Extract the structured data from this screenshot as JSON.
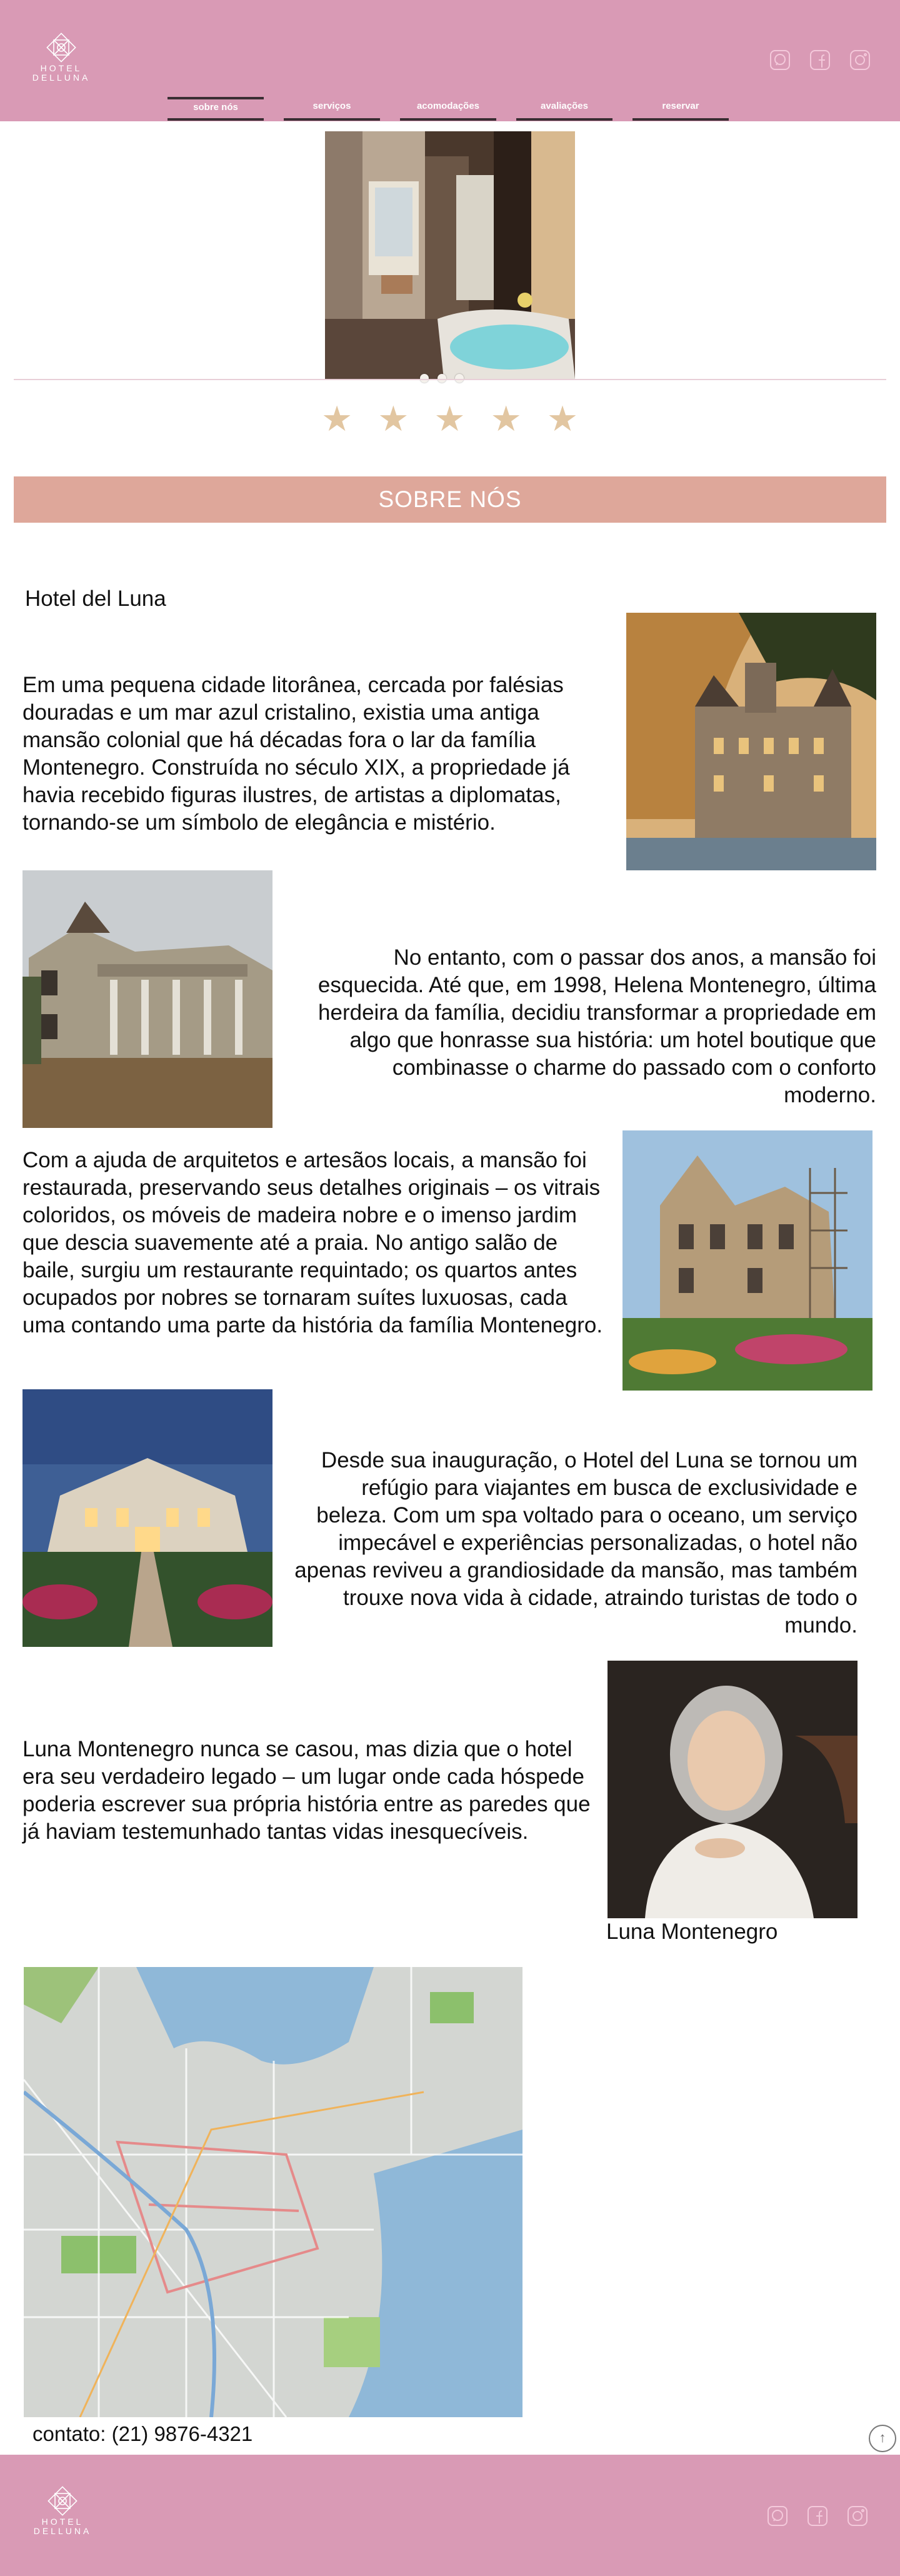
{
  "brand": {
    "line1": "HOTEL",
    "line2": "DELLUNA"
  },
  "social": [
    "whatsapp-icon",
    "facebook-icon",
    "instagram-icon"
  ],
  "nav": [
    {
      "label": "sobre nós",
      "active": true
    },
    {
      "label": "serviços"
    },
    {
      "label": "acomodações"
    },
    {
      "label": "avaliações"
    },
    {
      "label": "reservar"
    }
  ],
  "rating": {
    "stars": 5,
    "max": 5
  },
  "section_title": "SOBRE NÓS",
  "hotel_name": "Hotel del Luna",
  "paragraphs": [
    "Em uma pequena cidade litorânea, cercada por falésias douradas e um mar azul cristalino, existia uma antiga mansão colonial que há décadas fora o lar da família Montenegro. Construída no século XIX, a propriedade já havia recebido figuras ilustres, de artistas a diplomatas, tornando-se um símbolo de elegância e mistério.",
    "No entanto, com o passar dos anos, a mansão foi esquecida. Até que, em 1998, Helena Montenegro, última herdeira da família, decidiu transformar a propriedade em algo que honrasse sua história: um hotel boutique que combinasse o charme do passado com o conforto moderno.",
    "Com a ajuda de arquitetos e artesãos locais, a mansão foi restaurada, preservando seus detalhes originais – os vitrais coloridos, os móveis de madeira nobre e o imenso jardim que descia suavemente até a praia. No antigo salão de baile, surgiu um restaurante requintado; os quartos antes ocupados por nobres se tornaram suítes luxuosas, cada uma contando uma parte da história da família Montenegro.",
    "Desde sua inauguração, o Hotel del Luna se tornou um refúgio para viajantes em busca de exclusividade e beleza. Com um spa voltado para o oceano, um serviço impecável e experiências personalizadas, o hotel não apenas reviveu a grandiosidade da mansão, mas também trouxe nova vida à cidade, atraindo turistas de todo o mundo.",
    "Luna Montenegro nunca se casou, mas dizia que o hotel era seu verdadeiro legado – um lugar onde cada hóspede poderia escrever sua própria história entre as paredes que já haviam testemunhado tantas vidas inesquecíveis."
  ],
  "portrait_caption": "Luna Montenegro",
  "contact": "contato: (21) 9876-4321",
  "colors": {
    "brand_pink": "#d99ab5",
    "section_bar": "#dea79a",
    "star": "#e2c6a1",
    "tab_border": "#3a2e33"
  }
}
